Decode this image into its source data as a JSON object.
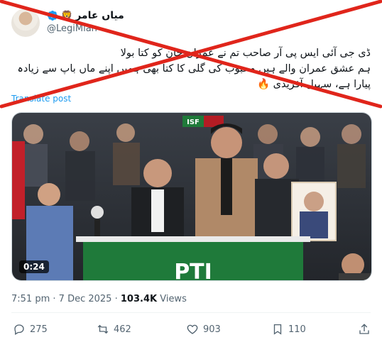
{
  "author": {
    "display_name": "میاں عامر",
    "emoji": "🦁",
    "handle": "@LegiMian"
  },
  "tweet": {
    "line1": "ڈی جی آئی ایس پی آر صاحب تم نے عمران خان کو کتا بولا",
    "line2": "ہم عشق عمران والے ہیں محبوب کی گلی کا کتا بھی ہمیں اپنے ماں باپ سے زیادہ پیارا ہے، سہیل آفریدی",
    "emoji": "🔥"
  },
  "translate_label": "Translate post",
  "media": {
    "duration": "0:24",
    "banner_text": "PTI",
    "isf_text": "ISF"
  },
  "meta": {
    "time": "7:51 pm",
    "separator": "·",
    "date": "7 Dec 2025",
    "views_count": "103.4K",
    "views_label": "Views"
  },
  "actions": {
    "replies": "275",
    "reposts": "462",
    "likes": "903",
    "bookmarks": "110"
  },
  "colors": {
    "accent": "#1d9bf0",
    "cross": "#e0251b",
    "verified": "#1d9bf0"
  }
}
